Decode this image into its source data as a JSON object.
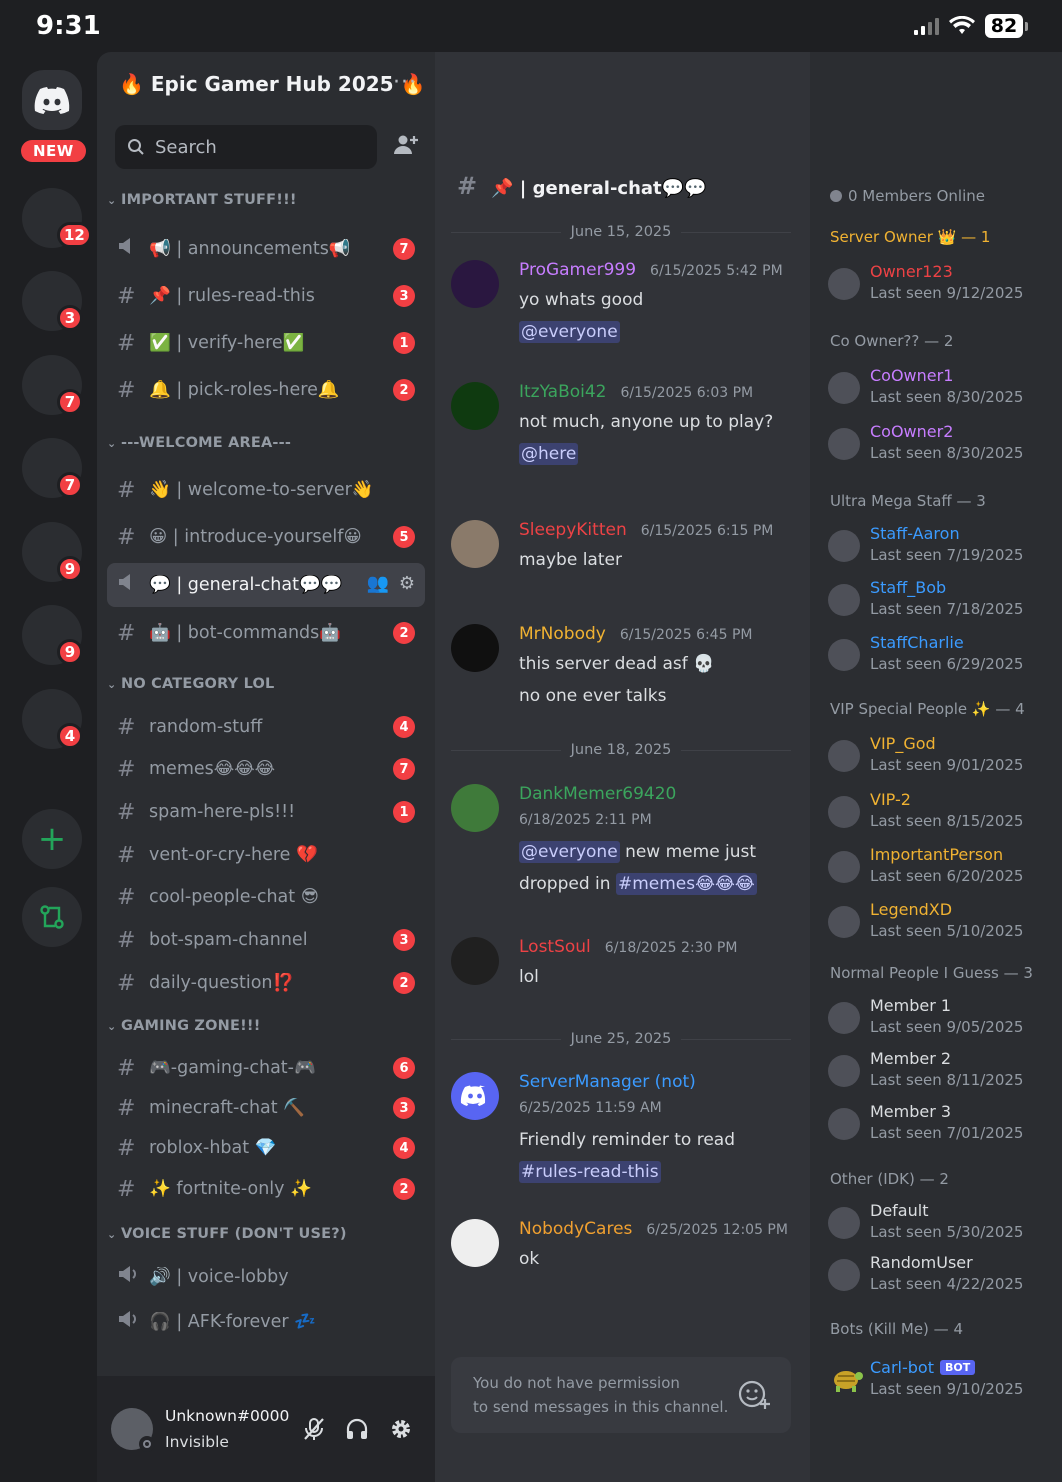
{
  "status_bar": {
    "time": "9:31",
    "battery": "82"
  },
  "server_rail": {
    "new_label": "NEW",
    "servers": [
      {
        "badge": "12"
      },
      {
        "badge": "3"
      },
      {
        "badge": "7"
      },
      {
        "badge": "7"
      },
      {
        "badge": "9"
      },
      {
        "badge": "9"
      },
      {
        "badge": "4"
      }
    ],
    "add_icon": "plus-icon",
    "discover_icon": "discover-icon"
  },
  "sidebar": {
    "server_name": "🔥 Epic Gamer Hub 2025 🔥",
    "more_label": "···",
    "search_placeholder": "Search",
    "categories": [
      {
        "name": "IMPORTANT STUFF!!!",
        "channels": [
          {
            "name": "📢 | announcements📢",
            "badge": "7",
            "type": "announcement"
          },
          {
            "name": "📌 | rules-read-this",
            "badge": "3",
            "type": "text"
          },
          {
            "name": "✅ | verify-here✅",
            "badge": "1",
            "type": "text"
          },
          {
            "name": "🔔 | pick-roles-here🔔",
            "badge": "2",
            "type": "text"
          }
        ]
      },
      {
        "name": "---WELCOME AREA---",
        "channels": [
          {
            "name": "👋 | welcome-to-server👋",
            "badge": "",
            "type": "text"
          },
          {
            "name": "😀 | introduce-yourself😀",
            "badge": "5",
            "type": "text"
          },
          {
            "name": "💬 | general-chat💬💬",
            "badge": "",
            "type": "announcement",
            "active": true
          },
          {
            "name": "🤖 | bot-commands🤖",
            "badge": "2",
            "type": "text"
          }
        ]
      },
      {
        "name": "NO CATEGORY LOL",
        "channels": [
          {
            "name": "random-stuff",
            "badge": "4",
            "type": "text"
          },
          {
            "name": "memes😂😂😂",
            "badge": "7",
            "type": "text"
          },
          {
            "name": "spam-here-pls!!!",
            "badge": "1",
            "type": "text"
          },
          {
            "name": "vent-or-cry-here 💔",
            "badge": "",
            "type": "text"
          },
          {
            "name": "cool-people-chat 😎",
            "badge": "",
            "type": "text"
          },
          {
            "name": "bot-spam-channel",
            "badge": "3",
            "type": "text"
          },
          {
            "name": "daily-question⁉️",
            "badge": "2",
            "type": "text"
          }
        ]
      },
      {
        "name": "GAMING ZONE!!!",
        "channels": [
          {
            "name": "🎮-gaming-chat-🎮",
            "badge": "6",
            "type": "text"
          },
          {
            "name": "minecraft-chat ⛏️",
            "badge": "3",
            "type": "text"
          },
          {
            "name": "roblox-hbat 💎",
            "badge": "4",
            "type": "text"
          },
          {
            "name": "✨ fortnite-only ✨",
            "badge": "2",
            "type": "text"
          }
        ]
      },
      {
        "name": "VOICE STUFF (DON'T USE?)",
        "channels": [
          {
            "name": "🔊 | voice-lobby",
            "badge": "",
            "type": "voice"
          },
          {
            "name": "🎧 | AFK-forever 💤",
            "badge": "",
            "type": "voice"
          }
        ]
      }
    ],
    "user": {
      "name": "Unknown#0000",
      "status": "Invisible"
    }
  },
  "chat": {
    "channel_title": "📌 | general-chat💬💬",
    "dividers": [
      "June 15, 2025",
      "June 18, 2025",
      "June 25, 2025"
    ],
    "messages": [
      {
        "author": "ProGamer999",
        "time": "6/15/2025 5:42 PM",
        "lines": [
          "yo whats good",
          "@everyone"
        ],
        "color": "#c77dff"
      },
      {
        "author": "ItzYaBoi42",
        "time": "6/15/2025 6:03 PM",
        "lines": [
          "not much, anyone up to play?",
          "@here"
        ],
        "color": "#3ba55d"
      },
      {
        "author": "SleepyKitten",
        "time": "6/15/2025 6:15 PM",
        "lines": [
          "maybe later"
        ],
        "color": "#ed4245"
      },
      {
        "author": "MrNobody",
        "time": "6/15/2025 6:45 PM",
        "lines": [
          "this server dead asf 💀",
          "no one ever talks"
        ],
        "color": "#f0b232"
      },
      {
        "author": "DankMemer69420",
        "time": "6/18/2025 2:11 PM",
        "lines": [
          "@everyone",
          "new meme just",
          "dropped in",
          "#memes😂😂😂"
        ],
        "color": "#3ba55d"
      },
      {
        "author": "LostSoul",
        "time": "6/18/2025 2:30 PM",
        "lines": [
          "lol"
        ],
        "color": "#ed4245"
      },
      {
        "author": "ServerManager (not)",
        "time": "6/25/2025 11:59 AM",
        "lines": [
          "Friendly reminder to read",
          "#rules-read-this"
        ],
        "color": "#3b9bff"
      },
      {
        "author": "NobodyCares",
        "time": "6/25/2025 12:05 PM",
        "lines": [
          "ok"
        ],
        "color": "#f0a030"
      }
    ],
    "input_placeholder": "You do not have permission to send messages in this channel.",
    "input_line1": "You do not have permission",
    "input_line2": "to send messages in this channel."
  },
  "members": {
    "online_label": "0 Members Online",
    "groups": [
      {
        "title": "Server Owner 👑 — 1",
        "color": "#f0b232",
        "members": [
          {
            "name": "Owner123",
            "seen": "Last seen 9/12/2025",
            "color": "#ed4245"
          }
        ]
      },
      {
        "title": "Co Owner?? — 2",
        "color": "#949ba4",
        "members": [
          {
            "name": "CoOwner1",
            "seen": "Last seen 8/30/2025",
            "color": "#c77dff"
          },
          {
            "name": "CoOwner2",
            "seen": "Last seen 8/30/2025",
            "color": "#c77dff"
          }
        ]
      },
      {
        "title": "Ultra Mega Staff — 3",
        "color": "#949ba4",
        "members": [
          {
            "name": "Staff-Aaron",
            "seen": "Last seen 7/19/2025",
            "color": "#3b9bff"
          },
          {
            "name": "Staff_Bob",
            "seen": "Last seen 7/18/2025",
            "color": "#3b9bff"
          },
          {
            "name": "StaffCharlie",
            "seen": "Last seen 6/29/2025",
            "color": "#3b9bff"
          }
        ]
      },
      {
        "title": "VIP Special People ✨ — 4",
        "color": "#949ba4",
        "members": [
          {
            "name": "VIP_God",
            "seen": "Last seen 9/01/2025",
            "color": "#f0b232"
          },
          {
            "name": "VIP-2",
            "seen": "Last seen 8/15/2025",
            "color": "#f0b232"
          },
          {
            "name": "ImportantPerson",
            "seen": "Last seen 6/20/2025",
            "color": "#f0b232"
          },
          {
            "name": "LegendXD",
            "seen": "Last seen 5/10/2025",
            "color": "#f0b232"
          }
        ]
      },
      {
        "title": "Normal People I Guess — 3",
        "color": "#949ba4",
        "members": [
          {
            "name": "Member 1",
            "seen": "Last seen 9/05/2025",
            "color": "#dbdee1"
          },
          {
            "name": "Member 2",
            "seen": "Last seen 8/11/2025",
            "color": "#dbdee1"
          },
          {
            "name": "Member 3",
            "seen": "Last seen 7/01/2025",
            "color": "#dbdee1"
          }
        ]
      },
      {
        "title": "Other (IDK) — 2",
        "color": "#949ba4",
        "members": [
          {
            "name": "Default",
            "seen": "Last seen 5/30/2025",
            "color": "#dbdee1"
          },
          {
            "name": "RandomUser",
            "seen": "Last seen 4/22/2025",
            "color": "#dbdee1"
          }
        ]
      },
      {
        "title": "Bots (Kill Me) — 4",
        "color": "#949ba4",
        "members": [
          {
            "name": "Carl-bot",
            "seen": "Last seen 9/10/2025",
            "color": "#3b9bff",
            "bot": "BOT"
          }
        ]
      }
    ]
  }
}
